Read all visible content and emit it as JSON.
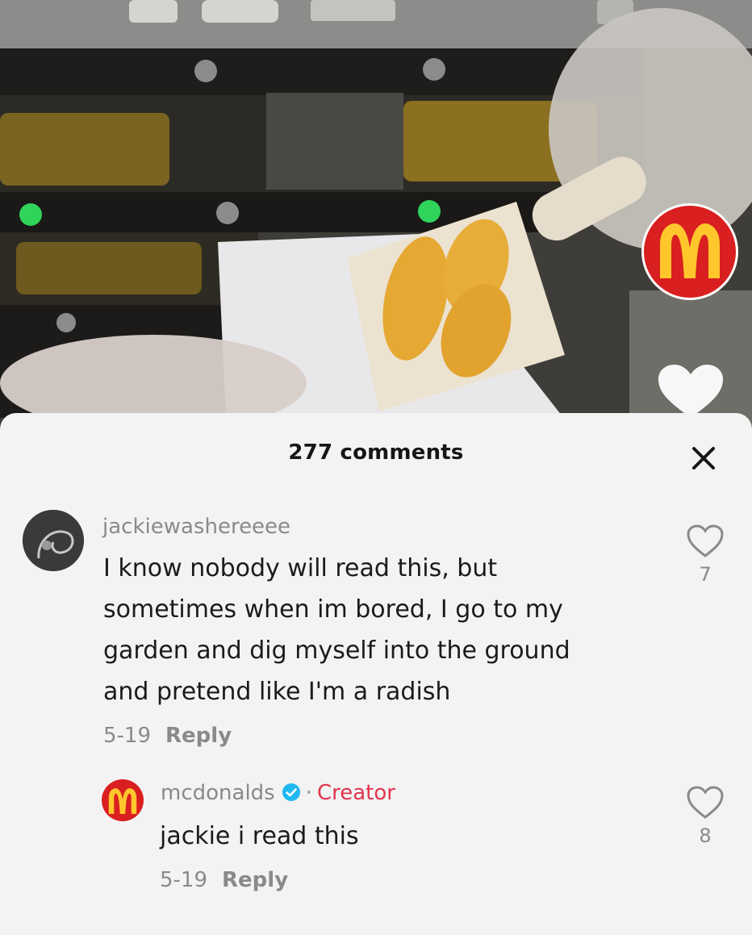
{
  "comments_panel": {
    "count_label": "277 comments",
    "close_symbol": "✕"
  },
  "comments": [
    {
      "username": "jackiewashereeee",
      "text_lines": [
        "I know nobody will read this, but",
        "sometimes when im bored, I go to my",
        "garden and dig myself into the ground",
        "and pretend like I'm a radish"
      ],
      "date": "5-19",
      "reply_label": "Reply",
      "likes": "7"
    },
    {
      "username": "mcdonalds",
      "separator": "·",
      "badge": "Creator",
      "text": "jackie i read this",
      "date": "5-19",
      "reply_label": "Reply",
      "likes": "8"
    }
  ],
  "icons": {
    "close": "close-icon",
    "like": "heart-outline-icon",
    "video_like": "heart-filled-icon",
    "verified": "verified-check-icon",
    "brand": "golden-arches-logo"
  },
  "colors": {
    "mcdonalds_red": "#d91f20",
    "mcdonalds_yellow": "#ffc72c",
    "creator_badge": "#e0344f",
    "verified_blue": "#20b8f0"
  }
}
